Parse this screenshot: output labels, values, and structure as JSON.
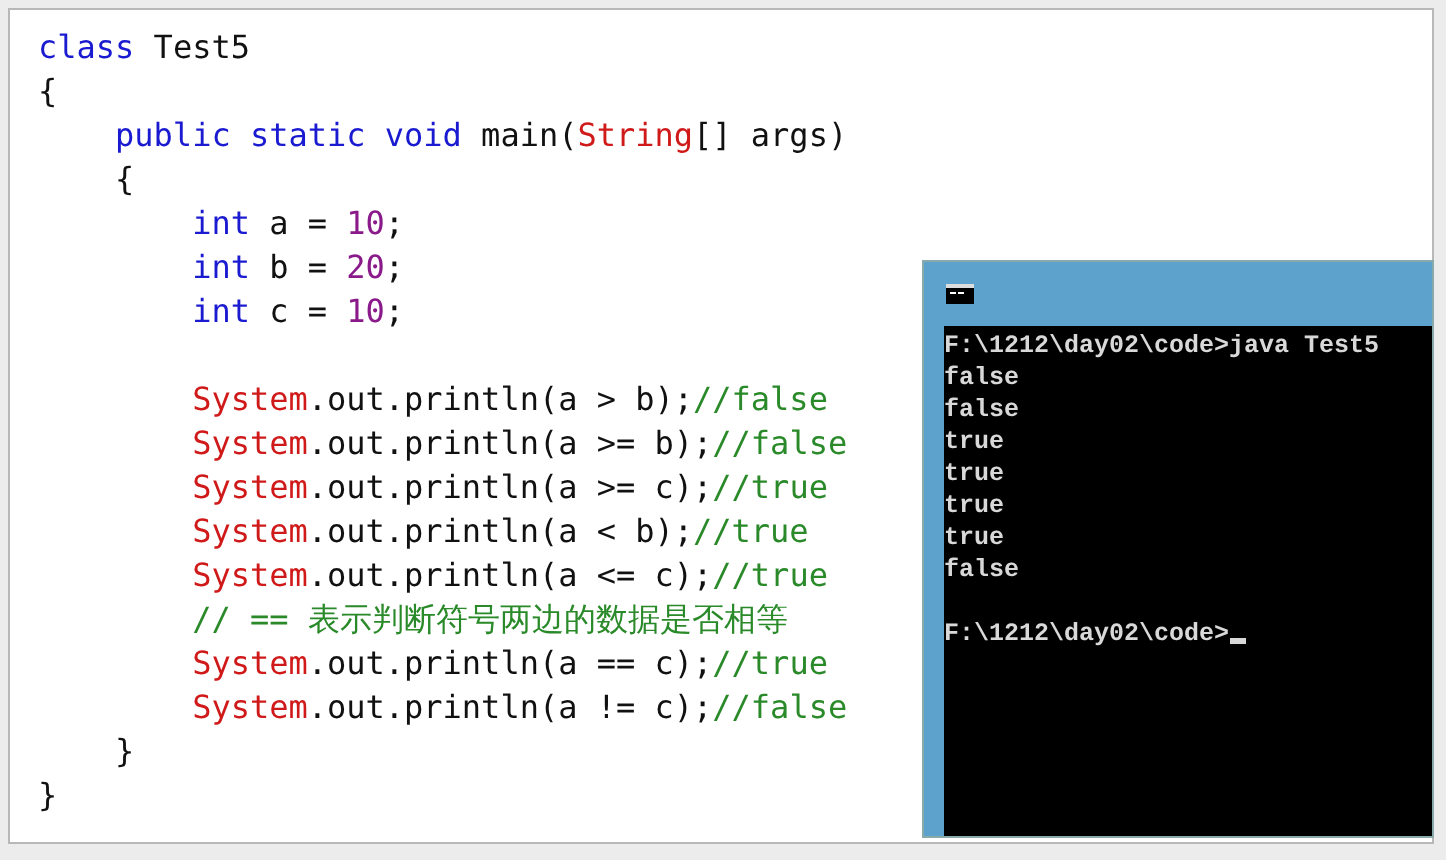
{
  "editor": {
    "lines": [
      {
        "kind": "code",
        "tokens": [
          {
            "text": "class",
            "kind": "keyword"
          },
          {
            "text": " Test5",
            "kind": "plain"
          }
        ]
      },
      {
        "kind": "code",
        "tokens": [
          {
            "text": "{",
            "kind": "plain"
          }
        ]
      },
      {
        "kind": "code",
        "tokens": [
          {
            "text": "    public static void",
            "kind": "keyword"
          },
          {
            "text": " main(",
            "kind": "plain"
          },
          {
            "text": "String",
            "kind": "type"
          },
          {
            "text": "[] args)",
            "kind": "plain"
          }
        ]
      },
      {
        "kind": "code",
        "tokens": [
          {
            "text": "    {",
            "kind": "plain"
          }
        ]
      },
      {
        "kind": "code",
        "tokens": [
          {
            "text": "        int",
            "kind": "keyword"
          },
          {
            "text": " a = ",
            "kind": "plain"
          },
          {
            "text": "10",
            "kind": "number"
          },
          {
            "text": ";",
            "kind": "plain"
          }
        ]
      },
      {
        "kind": "code",
        "tokens": [
          {
            "text": "        int",
            "kind": "keyword"
          },
          {
            "text": " b = ",
            "kind": "plain"
          },
          {
            "text": "20",
            "kind": "number"
          },
          {
            "text": ";",
            "kind": "plain"
          }
        ]
      },
      {
        "kind": "code",
        "tokens": [
          {
            "text": "        int",
            "kind": "keyword"
          },
          {
            "text": " c = ",
            "kind": "plain"
          },
          {
            "text": "10",
            "kind": "number"
          },
          {
            "text": ";",
            "kind": "plain"
          }
        ]
      },
      {
        "kind": "blank"
      },
      {
        "kind": "code",
        "tokens": [
          {
            "text": "        System",
            "kind": "type"
          },
          {
            "text": ".out.println(a > b);",
            "kind": "plain"
          },
          {
            "text": "//false",
            "kind": "comment"
          }
        ]
      },
      {
        "kind": "code",
        "tokens": [
          {
            "text": "        System",
            "kind": "type"
          },
          {
            "text": ".out.println(a >= b);",
            "kind": "plain"
          },
          {
            "text": "//false",
            "kind": "comment"
          }
        ]
      },
      {
        "kind": "code",
        "tokens": [
          {
            "text": "        System",
            "kind": "type"
          },
          {
            "text": ".out.println(a >= c);",
            "kind": "plain"
          },
          {
            "text": "//true",
            "kind": "comment"
          }
        ]
      },
      {
        "kind": "code",
        "tokens": [
          {
            "text": "        System",
            "kind": "type"
          },
          {
            "text": ".out.println(a < b);",
            "kind": "plain"
          },
          {
            "text": "//true",
            "kind": "comment"
          }
        ]
      },
      {
        "kind": "code",
        "tokens": [
          {
            "text": "        System",
            "kind": "type"
          },
          {
            "text": ".out.println(a <= c);",
            "kind": "plain"
          },
          {
            "text": "//true",
            "kind": "comment"
          }
        ]
      },
      {
        "kind": "code",
        "tokens": [
          {
            "text": "        // == 表示判断符号两边的数据是否相等",
            "kind": "comment"
          }
        ]
      },
      {
        "kind": "code",
        "tokens": [
          {
            "text": "        System",
            "kind": "type"
          },
          {
            "text": ".out.println(a == c);",
            "kind": "plain"
          },
          {
            "text": "//true",
            "kind": "comment"
          }
        ]
      },
      {
        "kind": "code",
        "tokens": [
          {
            "text": "        System",
            "kind": "type"
          },
          {
            "text": ".out.println(a != c);",
            "kind": "plain"
          },
          {
            "text": "//false",
            "kind": "comment"
          }
        ]
      },
      {
        "kind": "code",
        "tokens": [
          {
            "text": "    }",
            "kind": "plain"
          }
        ]
      },
      {
        "kind": "code",
        "tokens": [
          {
            "text": "}",
            "kind": "plain"
          }
        ]
      }
    ]
  },
  "console": {
    "lines": [
      {
        "kind": "text",
        "text": "F:\\1212\\day02\\code>java Test5",
        "cursor": false
      },
      {
        "kind": "text",
        "text": "false",
        "cursor": false
      },
      {
        "kind": "text",
        "text": "false",
        "cursor": false
      },
      {
        "kind": "text",
        "text": "true",
        "cursor": false
      },
      {
        "kind": "text",
        "text": "true",
        "cursor": false
      },
      {
        "kind": "text",
        "text": "true",
        "cursor": false
      },
      {
        "kind": "text",
        "text": "true",
        "cursor": false
      },
      {
        "kind": "text",
        "text": "false",
        "cursor": false
      },
      {
        "kind": "blank"
      },
      {
        "kind": "text",
        "text": "F:\\1212\\day02\\code>",
        "cursor": true
      }
    ]
  }
}
